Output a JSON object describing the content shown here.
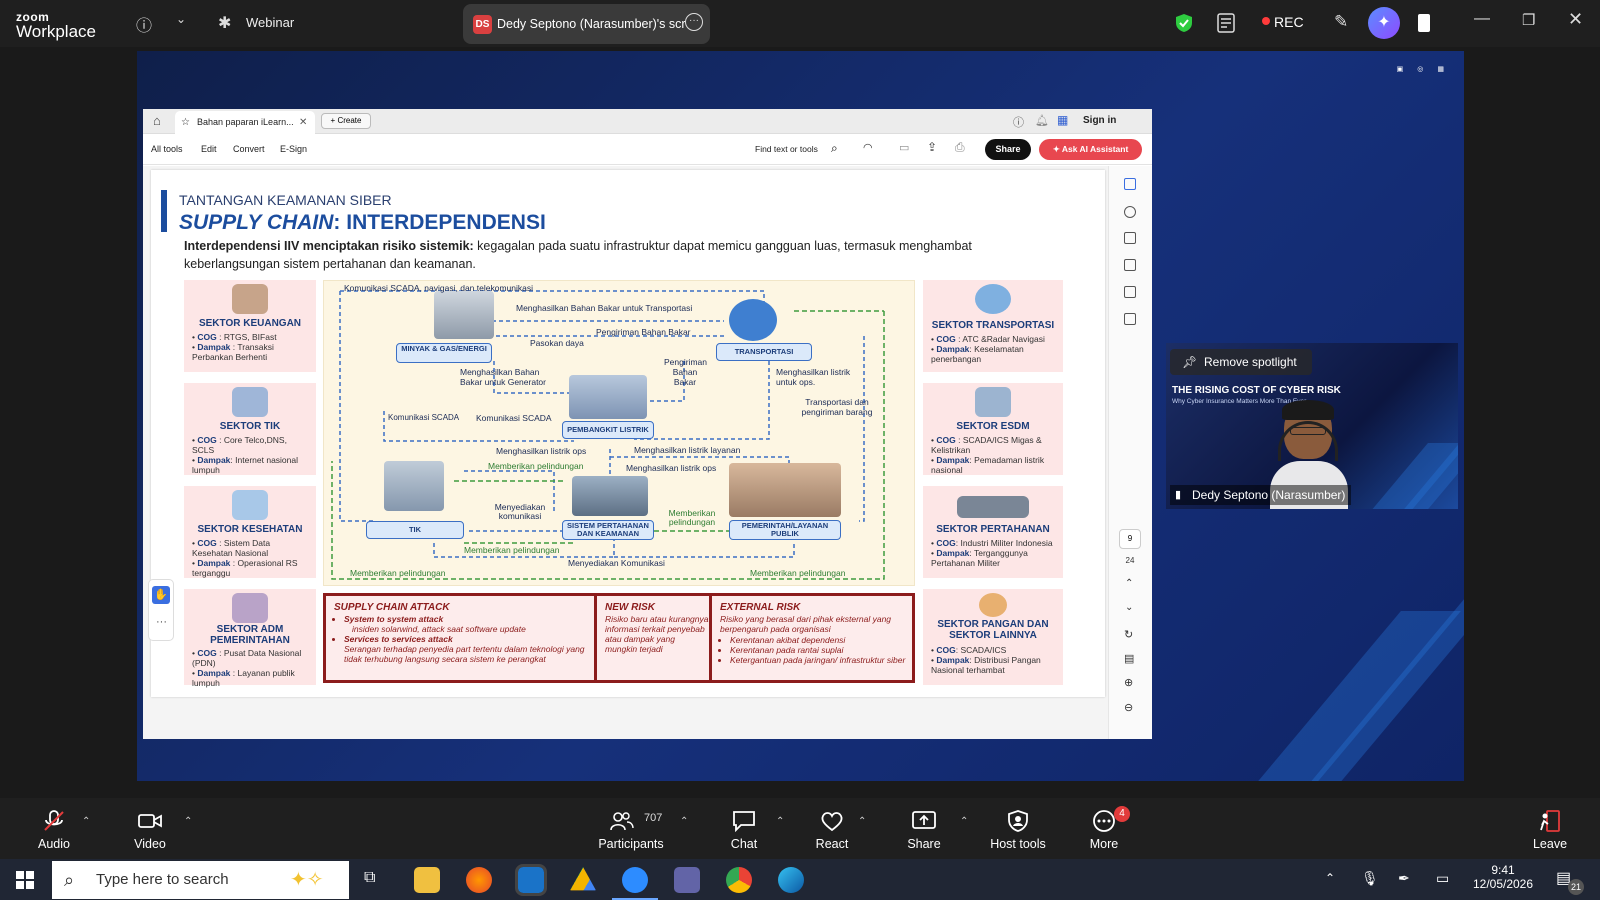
{
  "zoom": {
    "logo_top": "zoom",
    "logo_bottom": "Workplace",
    "webinar_label": "Webinar",
    "share_badge": "DS",
    "share_title": "Dedy Septono (Narasumber)'s scr",
    "rec_label": "REC"
  },
  "viewer": {
    "tab_title": "Bahan paparan iLearn...",
    "create_label": "Create",
    "sign_in": "Sign in",
    "menu": [
      "All tools",
      "Edit",
      "Convert",
      "E-Sign"
    ],
    "find_label": "Find text or tools",
    "share_label": "Share",
    "ai_label": "Ask AI Assistant",
    "page_current": "9",
    "page_total": "24"
  },
  "slide": {
    "subtitle": "TANTANGAN KEAMANAN SIBER",
    "title_italic": "SUPPLY CHAIN",
    "title_rest": ": INTERDEPENDENSI",
    "lead_bold": "Interdependensi IIV menciptakan risiko sistemik:",
    "lead_rest": " kegagalan pada suatu infrastruktur dapat memicu gangguan luas, termasuk menghambat keberlangsungan sistem pertahanan dan keamanan.",
    "sectors_left": [
      {
        "name": "SEKTOR KEUANGAN",
        "cog": "RTGS, BIFast",
        "dampak": "Transaksi Perbankan Berhenti"
      },
      {
        "name": "SEKTOR TIK",
        "cog": "Core Telco,DNS, SCLS",
        "dampak": "Internet nasional lumpuh"
      },
      {
        "name": "SEKTOR KESEHATAN",
        "cog": "Sistem Data Kesehatan Nasional",
        "dampak": "Operasional RS terganggu"
      },
      {
        "name": "SEKTOR ADM PEMERINTAHAN",
        "cog": "Pusat Data Nasional (PDN)",
        "dampak": "Layanan publik lumpuh"
      }
    ],
    "sectors_right": [
      {
        "name": "SEKTOR TRANSPORTASI",
        "cog": "ATC &Radar Navigasi",
        "dampak": "Keselamatan penerbangan"
      },
      {
        "name": "SEKTOR ESDM",
        "cog": "SCADA/ICS Migas & Kelistrikan",
        "dampak": "Pemadaman listrik nasional"
      },
      {
        "name": "SEKTOR PERTAHANAN",
        "cog": "Industri Militer Indonesia",
        "dampak": "Terganggunya Pertahanan Militer"
      },
      {
        "name": "SEKTOR PANGAN DAN SEKTOR LAINNYA",
        "cog": "SCADA/ICS",
        "dampak": "Distribusi Pangan Nasional terhambat"
      }
    ],
    "cog_label": "COG",
    "dampak_label": "Dampak",
    "nodes": {
      "migas": "MINYAK & GAS/ENERGI",
      "transport": "TRANSPORTASI",
      "pembangkit": "PEMBANGKIT LISTRIK",
      "tik": "TIK",
      "hankam": "SISTEM PERTAHANAN DAN KEAMANAN",
      "publik": "PEMERINTAH/LAYANAN PUBLIK"
    },
    "labels": {
      "l1": "Komunikasi SCADA, navigasi, dan telekomunikasi",
      "l2": "Menghasilkan Bahan Bakar untuk Transportasi",
      "l3": "Pasokan daya",
      "l4": "Pengiriman Bahan Bakar",
      "l5": "Menghasilkan Bahan Bakar untuk Generator",
      "l6": "Pengiriman Bahan Bakar",
      "l7": "Menghasilkan listrik untuk ops.",
      "l8": "Transportasi dan pengiriman barang",
      "l9": "Komunikasi SCADA",
      "l10": "Komunikasi SCADA",
      "l11": "Menghasilkan listrik ops",
      "l12": "Menghasilkan listrik layanan",
      "l13": "Memberikan pelindungan",
      "l14": "Menghasilkan listrik ops",
      "l15": "Menyediakan komunikasi",
      "l16": "Memberikan pelindungan",
      "l17": "Memberikan pelindungan",
      "l18": "Menyediakan Komunikasi",
      "l19": "Memberikan pelindungan",
      "l20": "Memberikan pelindungan"
    },
    "risk": {
      "c1_title": "SUPPLY CHAIN ATTACK",
      "c1_a": "System to system attack",
      "c1_a_sub": "insiden solarwind, attack saat software update",
      "c1_b": "Services to services attack",
      "c1_b_sub": "Serangan terhadap penyedia part tertentu dalam teknologi yang tidak terhubung langsung secara sistem ke perangkat",
      "c2_title": "NEW RISK",
      "c2_text": "Risiko baru atau kurangnya informasi terkait penyebab atau dampak yang mungkin terjadi",
      "c3_title": "EXTERNAL RISK",
      "c3_text": "Risiko yang berasal dari pihak eksternal yang berpengaruh pada organisasi",
      "c3_items": [
        "Kerentanan akibat dependensi",
        "Kerentanan pada rantai suplai",
        "Ketergantuan pada jaringan/ infrastruktur siber"
      ]
    }
  },
  "camera": {
    "spotlight_label": "Remove spotlight",
    "title": "THE RISING COST OF CYBER RISK",
    "subtitle": "Why Cyber Insurance Matters More Than Ever",
    "participant": "Dedy Septono (Narasumber)"
  },
  "controls": {
    "audio": "Audio",
    "video": "Video",
    "participants": "Participants",
    "participants_count": "707",
    "chat": "Chat",
    "react": "React",
    "share": "Share",
    "host_tools": "Host tools",
    "more": "More",
    "more_badge": "4",
    "leave": "Leave"
  },
  "taskbar": {
    "search_placeholder": "Type here to search",
    "time": "9:41",
    "date": "12/05/2026",
    "notif_count": "21"
  },
  "colors": {
    "accent_blue": "#1c4d9e",
    "risk_red": "#8c1c1c",
    "ai_button": "#e8474f",
    "sector_pink": "#fde6e6"
  }
}
